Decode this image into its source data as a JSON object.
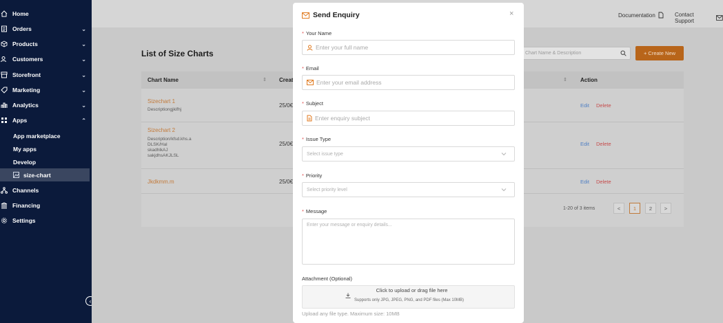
{
  "sidebar": {
    "items": [
      {
        "label": "Home",
        "icon": "home-icon"
      },
      {
        "label": "Orders",
        "icon": "orders-icon"
      },
      {
        "label": "Products",
        "icon": "products-icon"
      },
      {
        "label": "Customers",
        "icon": "customers-icon"
      },
      {
        "label": "Storefront",
        "icon": "storefront-icon"
      },
      {
        "label": "Marketing",
        "icon": "marketing-icon"
      },
      {
        "label": "Analytics",
        "icon": "analytics-icon"
      },
      {
        "label": "Apps",
        "icon": "apps-icon"
      },
      {
        "label": "Channels",
        "icon": "channels-icon"
      },
      {
        "label": "Financing",
        "icon": "financing-icon"
      },
      {
        "label": "Settings",
        "icon": "settings-icon"
      }
    ],
    "sub_items": [
      "App marketplace",
      "My apps",
      "Develop",
      "size-chart"
    ],
    "collapse_glyph": "‹"
  },
  "header": {
    "documentation": "Documentation",
    "contact_support": "Contact Support"
  },
  "page": {
    "title": "List of Size Charts",
    "search_placeholder": "Chart Name & Description",
    "create_button": "+ Create New",
    "columns": {
      "chart_name": "Chart Name",
      "created": "Creat",
      "action": "Action"
    },
    "rows": [
      {
        "name": "Sizechart 1",
        "description": "Descriptiongjkifhj",
        "date": "25/0€"
      },
      {
        "name": "Sizechart 2",
        "description_lines": [
          "Description/kfsd.khs.a",
          "DLSK/Hal",
          "skadhlkAJ",
          "sakjdhsAKJLSL"
        ],
        "date": "25/0€"
      },
      {
        "name": "Jkdkmm.m",
        "description": "",
        "date": "25/0€"
      }
    ],
    "edit_label": "Edit",
    "delete_label": "Delete",
    "pagination": {
      "summary": "1-20 of 3 items",
      "prev": "<",
      "page1": "1",
      "page2": "2",
      "next": ">"
    }
  },
  "modal": {
    "title": "Send Enquiry",
    "close": "×",
    "fields": {
      "name_label": "Your Name",
      "name_placeholder": "Enter your full name",
      "email_label": "Email",
      "email_placeholder": "Enter your email address",
      "subject_label": "Subject",
      "subject_placeholder": "Enter enquiry subject",
      "issue_label": "Issue Type",
      "issue_placeholder": "Select issue type",
      "priority_label": "Priority",
      "priority_placeholder": "Select priority level",
      "message_label": "Message",
      "message_placeholder": "Enter your message or enquiry details...",
      "attachment_label": "Attachment (Optional)",
      "upload_main": "Click to upload or drag file here",
      "upload_sub": "Supports only JPG, JPEG, PNG, and PDF files (Max 10MB)",
      "upload_hint": "Upload any file type. Maximum size: 10MB",
      "required_mark": "*"
    }
  },
  "colors": {
    "sidebar_bg": "#0b1a3b",
    "accent": "#e07a1f",
    "required": "#e04f4f"
  }
}
